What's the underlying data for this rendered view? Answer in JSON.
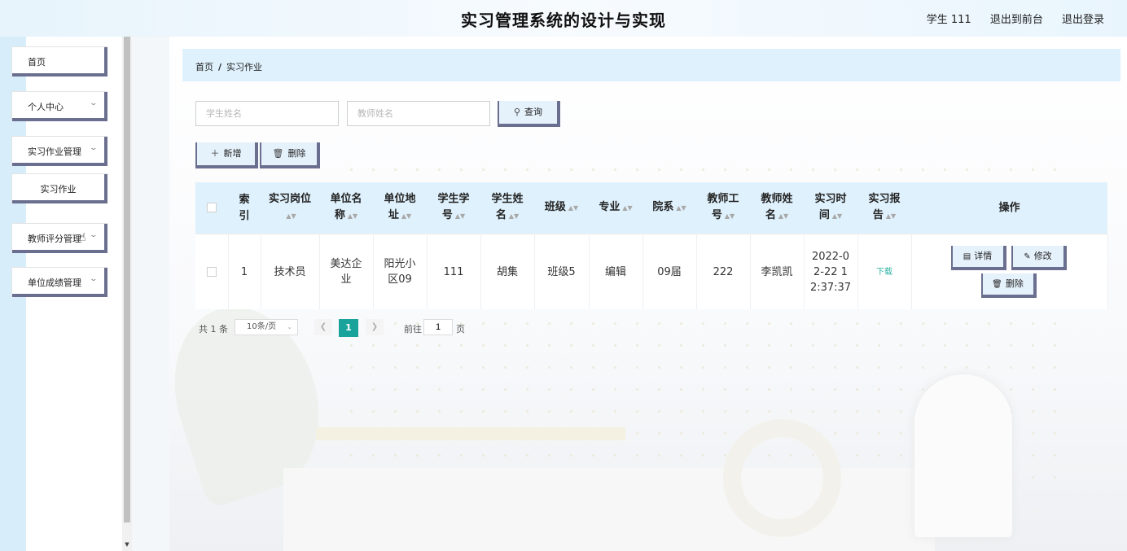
{
  "header": {
    "title": "实习管理系统的设计与实现",
    "user": "学生 111",
    "to_front": "退出到前台",
    "logout": "退出登录"
  },
  "sidebar": {
    "items": [
      {
        "label": "首页"
      },
      {
        "label": "个人中心"
      },
      {
        "label": "实习作业管理"
      },
      {
        "label": "实习作业"
      },
      {
        "label": "教师评分管理"
      },
      {
        "label": "单位成绩管理"
      }
    ]
  },
  "breadcrumb": {
    "home": "首页",
    "separator": "/",
    "current": "实习作业"
  },
  "search": {
    "student_placeholder": "学生姓名",
    "teacher_placeholder": "教师姓名",
    "query_label": "查询"
  },
  "toolbar": {
    "add_label": "新增",
    "delete_label": "删除"
  },
  "table": {
    "headers": {
      "index": [
        "索",
        "引"
      ],
      "position": [
        "实习岗位",
        ""
      ],
      "company": [
        "单位名",
        "称"
      ],
      "address": [
        "单位地",
        "址"
      ],
      "student_no": [
        "学生学",
        "号"
      ],
      "student_name": [
        "学生姓",
        "名"
      ],
      "class": [
        "班级",
        ""
      ],
      "major": [
        "专业",
        ""
      ],
      "department": [
        "院系",
        ""
      ],
      "teacher_no": [
        "教师工",
        "号"
      ],
      "teacher_name": [
        "教师姓",
        "名"
      ],
      "time": [
        "实习时",
        "间"
      ],
      "report": [
        "实习报",
        "告"
      ],
      "actions": "操作"
    },
    "rows": [
      {
        "index": "1",
        "position": "技术员",
        "company": [
          "美达企",
          "业"
        ],
        "address": [
          "阳光小",
          "区09"
        ],
        "student_no": "111",
        "student_name": "胡集",
        "class": "班级5",
        "major": "编辑",
        "department": "09届",
        "teacher_no": "222",
        "teacher_name": "李凯凯",
        "time": [
          "2022-0",
          "2-22 1",
          "2:37:37"
        ],
        "report": "下载",
        "detail_label": "详情",
        "edit_label": "修改",
        "delete_label": "删除"
      }
    ]
  },
  "pagination": {
    "total": "共 1 条",
    "page_size": "10条/页",
    "current_page": "1",
    "goto_label": "前往",
    "goto_value": "1",
    "page_unit": "页"
  },
  "icons": {
    "chevron": "chevron-down-icon",
    "search": "search-icon",
    "plus": "plus-icon",
    "trash": "trash-icon",
    "detail": "document-icon",
    "edit": "pencil-icon",
    "cursor": "hand-cursor-icon"
  }
}
